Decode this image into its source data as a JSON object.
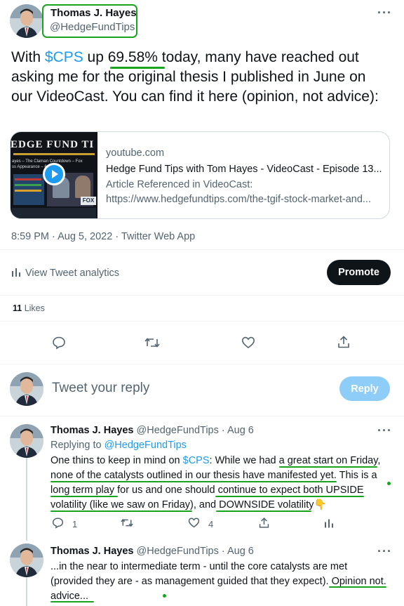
{
  "author": {
    "name": "Thomas J. Hayes",
    "handle": "@HedgeFundTips"
  },
  "tweet": {
    "text_part1": "With ",
    "cashtag": "$CPS",
    "text_part2": " up ",
    "percent": "69.58%",
    "text_part3": " today, many have reached out asking me for the original thesis I published in June on our VideoCast.  You can find it here (opinion, not advice):",
    "timestamp": "8:59 PM · Aug 5, 2022 · Twitter Web App"
  },
  "card": {
    "thumbnail_banner": "EDGE FUND TI",
    "thumbnail_caption": "ayes – The Claman Countdown – Fox\nss Appearance – 6/7/2022",
    "domain": "youtube.com",
    "title": "Hedge Fund Tips with Tom Hayes - VideoCast - Episode 13...",
    "description_line1": "Article Referenced in VideoCast:",
    "description_line2": "https://www.hedgefundtips.com/the-tgif-stock-market-and..."
  },
  "analytics": {
    "label": "View Tweet analytics",
    "promote_label": "Promote"
  },
  "likes": {
    "count": "11",
    "label": " Likes"
  },
  "compose": {
    "placeholder": "Tweet your reply",
    "button_label": "Reply"
  },
  "replies": [
    {
      "name": "Thomas J. Hayes",
      "handle": "@HedgeFundTips",
      "date": "· Aug 6",
      "replying_prefix": "Replying to ",
      "replying_handle": "@HedgeFundTips",
      "line1_a": "One thins to keep in mind on ",
      "line1_cashtag": "$CPS",
      "line1_b": ":  While we had a great start on Friday,",
      "line2": "none of the catalysts outlined in our thesis have manifested yet.  This is a",
      "line3": "long term play for us and one should continue to expect both UPSIDE",
      "line4": "volatility (like we saw on Friday), and DOWNSIDE volatility",
      "emoji": "👇",
      "reply_count": "1",
      "retweet_count": "",
      "like_count": "4"
    },
    {
      "name": "Thomas J. Hayes",
      "handle": "@HedgeFundTips",
      "date": "· Aug 6",
      "line1": "...in the near to intermediate term - until the core catalysts are met",
      "line2": "(provided they are - as management guided that they expect).  Opinion not.",
      "line3": "advice..."
    }
  ],
  "colors": {
    "accent": "#1d9bf0",
    "annotation": "#1aa31e",
    "promote_bg": "#0f1419",
    "reply_button_bg": "#8ecdf8"
  }
}
